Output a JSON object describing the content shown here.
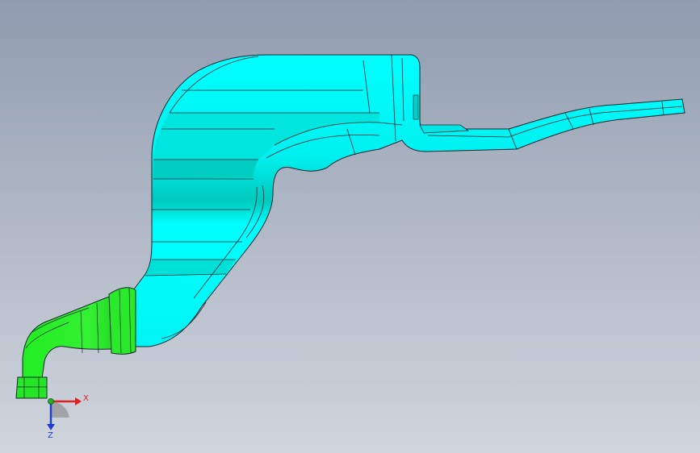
{
  "viewport": {
    "background_top": "#8f9caf",
    "background_bottom": "#d0d5dd"
  },
  "model": {
    "part_color": "#00ffff",
    "part_shade_color": "#00d6c8",
    "part_dark_color": "#00a89c",
    "connector_color": "#1ee61e",
    "connector_shade_color": "#16c016",
    "edge_color": "#1a2430"
  },
  "triad": {
    "x_label": "X",
    "z_label": "Z",
    "x_color": "#e02020",
    "z_color": "#2040d0",
    "y_color": "#20b020"
  }
}
